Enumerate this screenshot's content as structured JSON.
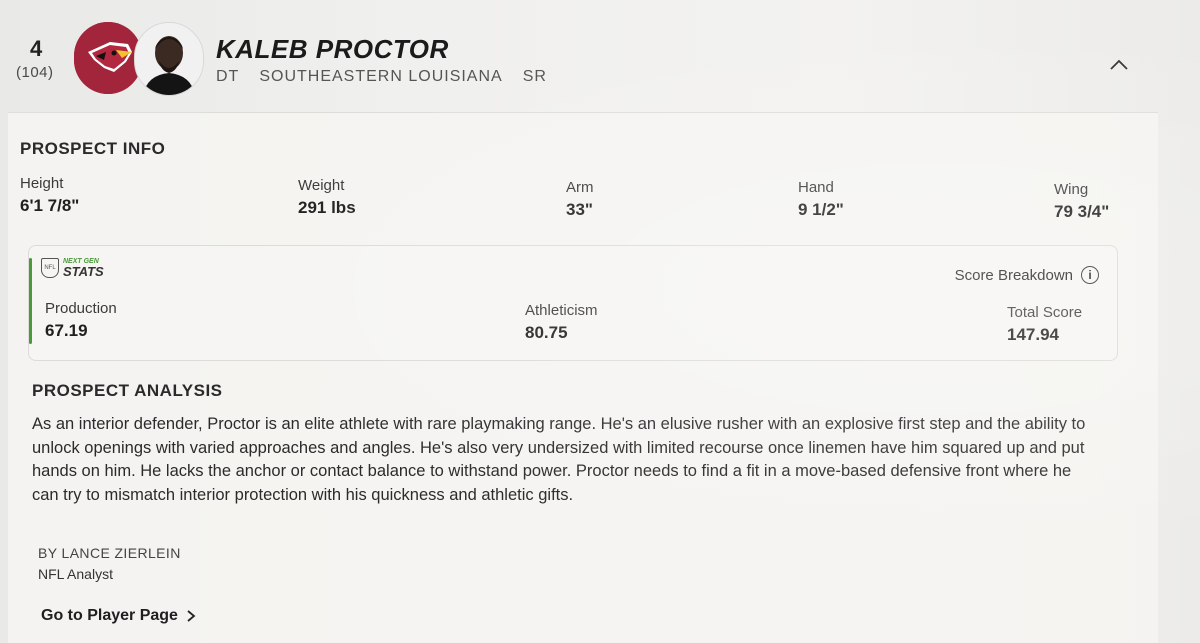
{
  "header": {
    "pick_number": "4",
    "pick_overall": "(104)",
    "player_name": "KALEB PROCTOR",
    "position": "DT",
    "school": "SOUTHEASTERN LOUISIANA",
    "class_year": "SR"
  },
  "prospect_info": {
    "title": "PROSPECT INFO",
    "stats": [
      {
        "label": "Height",
        "value": "6'1 7/8\""
      },
      {
        "label": "Weight",
        "value": "291 lbs"
      },
      {
        "label": "Arm",
        "value": "33\""
      },
      {
        "label": "Hand",
        "value": "9 1/2\""
      },
      {
        "label": "Wing",
        "value": "79 3/4\""
      }
    ]
  },
  "next_gen_stats": {
    "logo_small": "NEXT GEN",
    "logo_big": "STATS",
    "score_breakdown_label": "Score Breakdown",
    "scores": [
      {
        "label": "Production",
        "value": "67.19"
      },
      {
        "label": "Athleticism",
        "value": "80.75"
      },
      {
        "label": "Total Score",
        "value": "147.94"
      }
    ]
  },
  "prospect_analysis": {
    "title": "PROSPECT ANALYSIS",
    "text": "As an interior defender, Proctor is an elite athlete with rare playmaking range. He's an elusive rusher with an explosive first step and the ability to unlock openings with varied approaches and angles. He's also very undersized with limited recourse once linemen have him squared up and put hands on him. He lacks the anchor or contact balance to withstand power. Proctor needs to find a fit in a move-based defensive front where he can try to mismatch interior protection with his quickness and athletic gifts.",
    "byline": "BY LANCE ZIERLEIN",
    "role": "NFL Analyst"
  },
  "footer": {
    "player_page_link": "Go to Player Page"
  },
  "colors": {
    "team_primary": "#a3253c",
    "ngs_accent": "#4a9a3a"
  },
  "icons": {
    "collapse": "chevron-up-icon",
    "info": "info-icon",
    "link_arrow": "chevron-right-icon",
    "team_logo": "cardinals-logo",
    "player_photo": "player-headshot"
  }
}
